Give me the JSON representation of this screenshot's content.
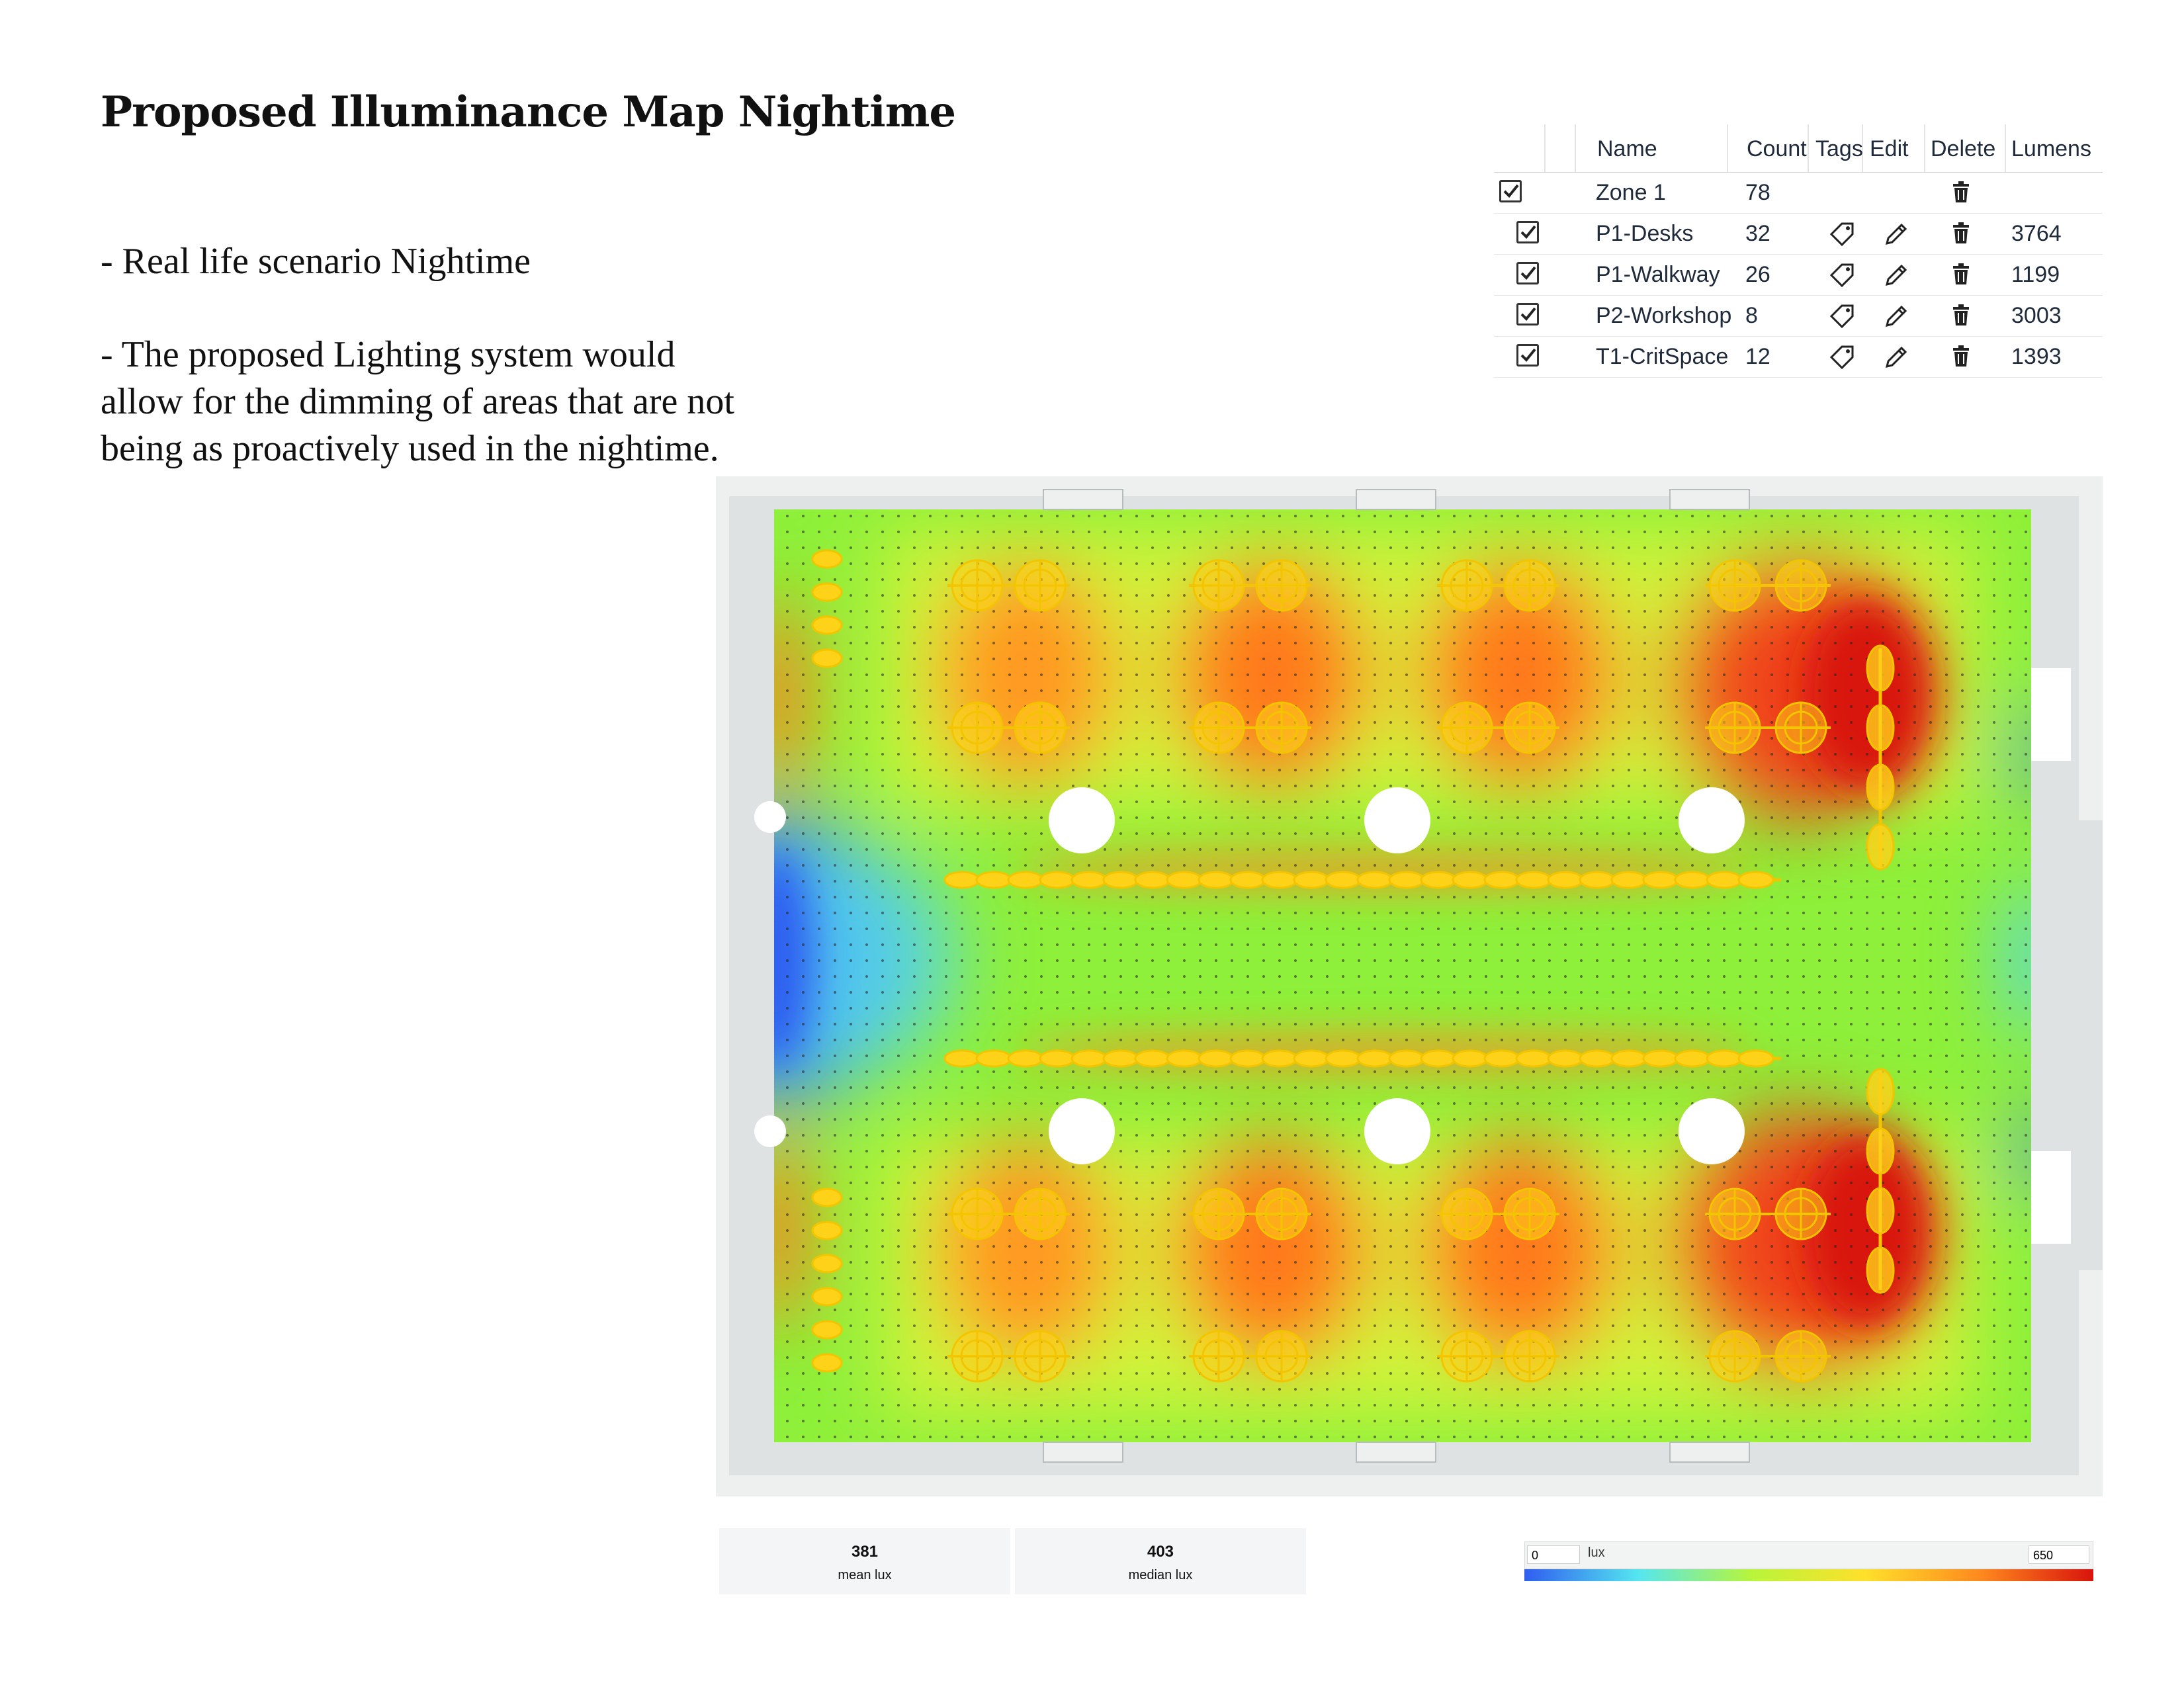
{
  "page": {
    "title": "Proposed Illuminance Map Nightime",
    "bullets": [
      "- Real life scenario Nightime",
      "- The proposed Lighting system would allow for the dimming of areas that are  not being as proactively used in the nightime."
    ]
  },
  "zones_table": {
    "headers": {
      "name": "Name",
      "count": "Count",
      "tags": "Tags",
      "edit": "Edit",
      "delete": "Delete",
      "lumens": "Lumens"
    },
    "rows": [
      {
        "name": "Zone 1",
        "count": "78",
        "lumens": "",
        "checked": true
      },
      {
        "name": "P1-Desks",
        "count": "32",
        "lumens": "3764",
        "checked": true
      },
      {
        "name": "P1-Walkway",
        "count": "26",
        "lumens": "1199",
        "checked": true
      },
      {
        "name": "P2-Workshop",
        "count": "8",
        "lumens": "3003",
        "checked": true
      },
      {
        "name": "T1-CritSpace",
        "count": "12",
        "lumens": "1393",
        "checked": true
      }
    ],
    "icons": {
      "tag": "tag-icon",
      "edit": "pencil-icon",
      "delete": "trash-icon",
      "check": "checkmark-icon"
    }
  },
  "stats": {
    "mean": {
      "value": "381",
      "label": "mean lux"
    },
    "median": {
      "value": "403",
      "label": "median lux"
    }
  },
  "legend": {
    "min": "0",
    "max": "650",
    "unit": "lux",
    "colors": [
      "#2f5ef0",
      "#54e6f0",
      "#b8f53a",
      "#ffe02a",
      "#ff8a1e",
      "#d8140c"
    ]
  },
  "map": {
    "colors": {
      "cool": "#3c7cf0",
      "base": "#8ef03a",
      "warm": "#ff8a1e",
      "hot": "#d8140c",
      "fixture": "#ffd21a",
      "wall": "#dfe2e2"
    }
  }
}
